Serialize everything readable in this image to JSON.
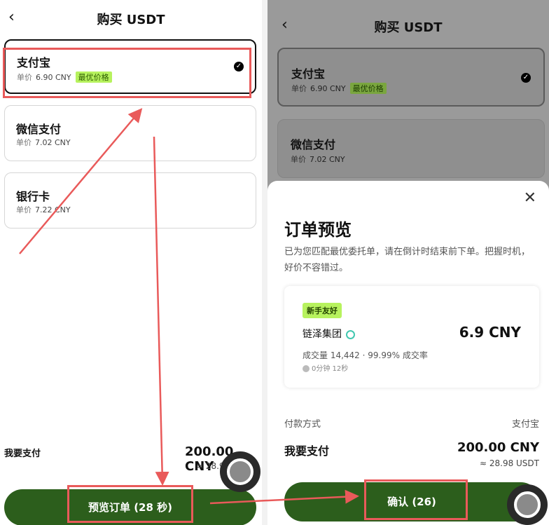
{
  "left": {
    "title": "购买 USDT",
    "back_icon": "chevron-left-icon",
    "methods": [
      {
        "name": "支付宝",
        "price_label": "单价",
        "price": "6.90 CNY",
        "badge": "最优价格",
        "selected": true
      },
      {
        "name": "微信支付",
        "price_label": "单价",
        "price": "7.02 CNY"
      },
      {
        "name": "银行卡",
        "price_label": "单价",
        "price": "7.22 CNY"
      }
    ],
    "pay_label": "我要支付",
    "pay_amount": "200.00 CNY",
    "pay_approx": "= 28.9",
    "preview_button": "预览订单 (28 秒)"
  },
  "right": {
    "title": "购买 USDT",
    "methods": [
      {
        "name": "支付宝",
        "price_label": "单价",
        "price": "6.90 CNY",
        "badge": "最优价格"
      },
      {
        "name": "微信支付",
        "price_label": "单价",
        "price": "7.02 CNY"
      }
    ],
    "sheet": {
      "title": "订单预览",
      "description": "已为您匹配最优委托单，请在倒计时结束前下单。把握时机，好价不容错过。",
      "tag": "新手友好",
      "merchant": "链泽集团",
      "price": "6.9 CNY",
      "stats": "成交量 14,442 · 99.99% 成交率",
      "time": "0分钟 12秒",
      "pay_method_label": "付款方式",
      "pay_method_value": "支付宝",
      "pay_label": "我要支付",
      "pay_amount": "200.00 CNY",
      "pay_approx": "≈ 28.98 USDT",
      "confirm_button": "确认 (26)"
    }
  },
  "colors": {
    "accent_green": "#2c5e1c",
    "badge_green": "#b7f25e",
    "annotation_red": "#e95a5a"
  }
}
